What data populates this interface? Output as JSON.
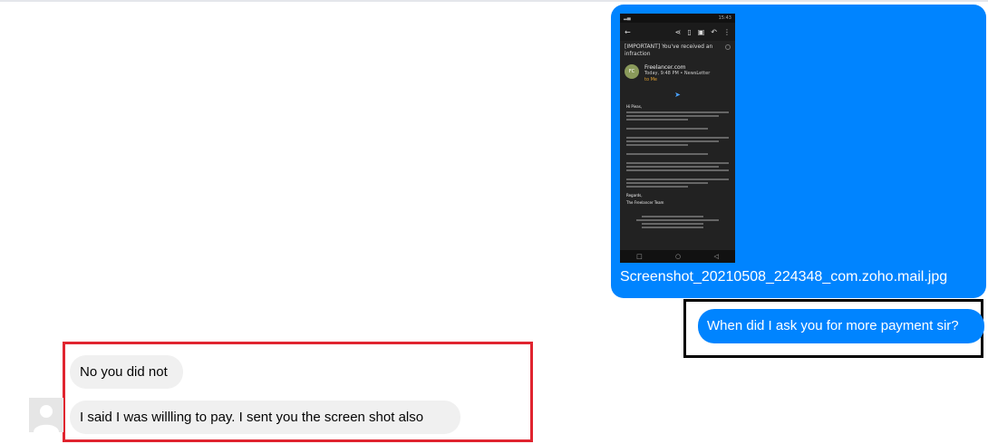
{
  "attachment": {
    "filename": "Screenshot_20210508_224348_com.zoho.mail.jpg",
    "phone": {
      "status_right": "15:43",
      "subject": "[IMPORTANT] You've received an infraction",
      "avatar_initials": "FC",
      "sender_name": "Freelancer.com",
      "sender_time": "Today, 9:48 PM  •  NewsLetter",
      "to_line": "to Me",
      "greeting": "Hi Pieas,",
      "regards": "Regards,",
      "signoff": "The Freelancer Team"
    }
  },
  "messages": {
    "outgoing": "When did I ask you for more payment sir?",
    "incoming_1": "No you did not",
    "incoming_2": "I said I was willling to pay. I sent you the screen shot also"
  },
  "colors": {
    "outgoing_bubble": "#0084ff",
    "incoming_bubble": "#f0f0f0",
    "highlight_red": "#e0242f",
    "highlight_black": "#000000"
  }
}
